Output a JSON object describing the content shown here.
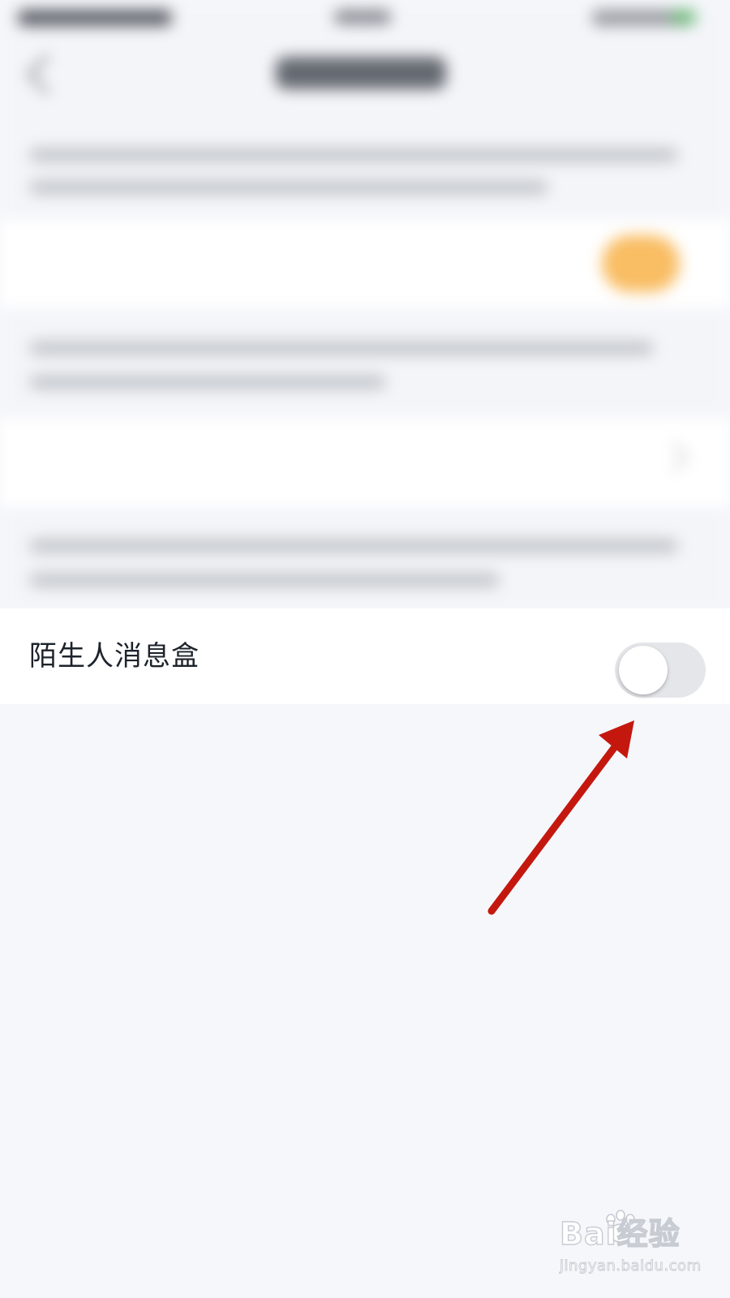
{
  "setting": {
    "label": "陌生人消息盒",
    "enabled": false
  },
  "watermark": {
    "logo": "Bai经验",
    "url": "jingyan.baidu.com"
  },
  "colors": {
    "background": "#f6f7fb",
    "row_background": "#ffffff",
    "toggle_off_track": "#e5e6e9",
    "toggle_on_accent": "#f9bd63",
    "annotation_arrow": "#c4180f"
  }
}
